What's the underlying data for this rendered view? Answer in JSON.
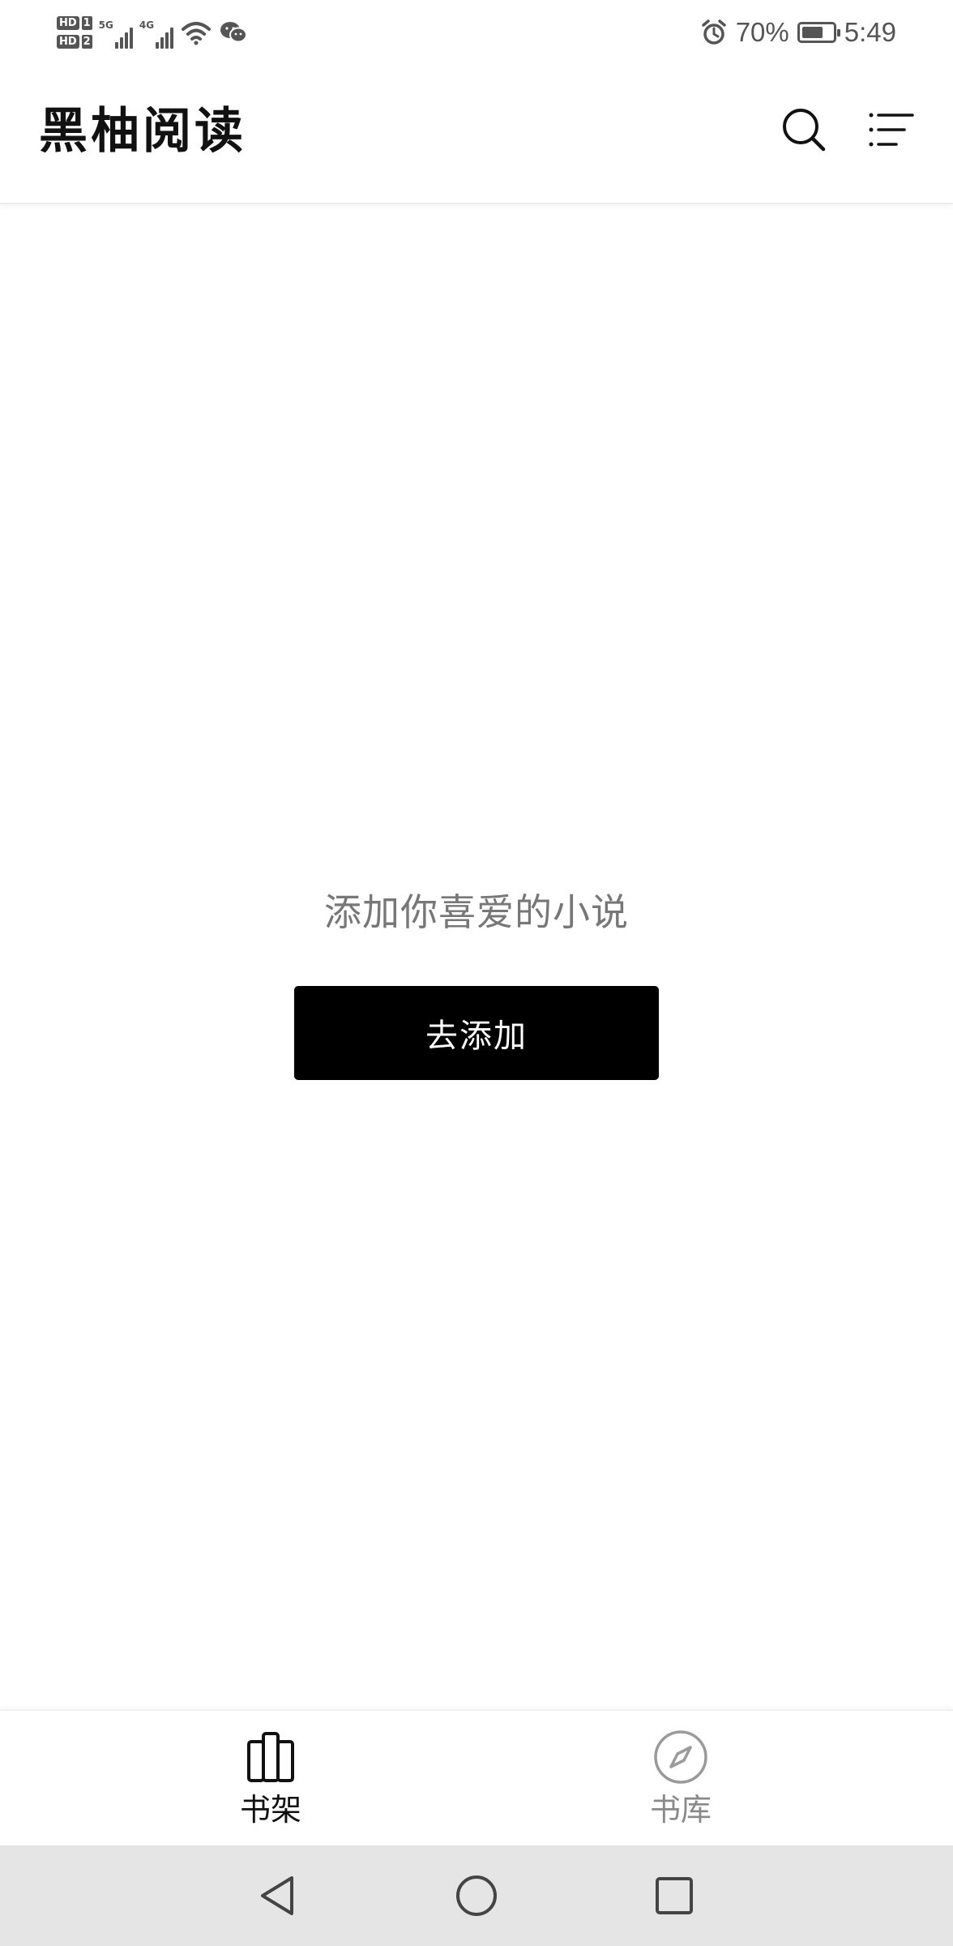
{
  "status_bar": {
    "sim1_badge": "HD",
    "sim1_num": "1",
    "sim2_badge": "HD",
    "sim2_num": "2",
    "net1_label": "5G",
    "net2_label": "4G",
    "battery_percent": "70%",
    "battery_level": 0.7,
    "time": "5:49",
    "icons": [
      "wifi-icon",
      "wechat-icon",
      "alarm-icon",
      "battery-icon"
    ]
  },
  "header": {
    "title": "黑柚阅读",
    "search_icon": "search-icon",
    "menu_icon": "menu-icon"
  },
  "empty_state": {
    "message": "添加你喜爱的小说",
    "button_label": "去添加"
  },
  "bottom_nav": {
    "items": [
      {
        "label": "书架",
        "icon": "bookshelf-icon",
        "active": true
      },
      {
        "label": "书库",
        "icon": "compass-icon",
        "active": false
      }
    ]
  },
  "system_nav": {
    "buttons": [
      "back-icon",
      "home-icon",
      "recent-apps-icon"
    ]
  },
  "colors": {
    "accent": "#000000",
    "active_text": "#111111",
    "inactive_text": "#8a8a8a",
    "background": "#ffffff",
    "system_nav_bg": "#e5e5e5"
  }
}
